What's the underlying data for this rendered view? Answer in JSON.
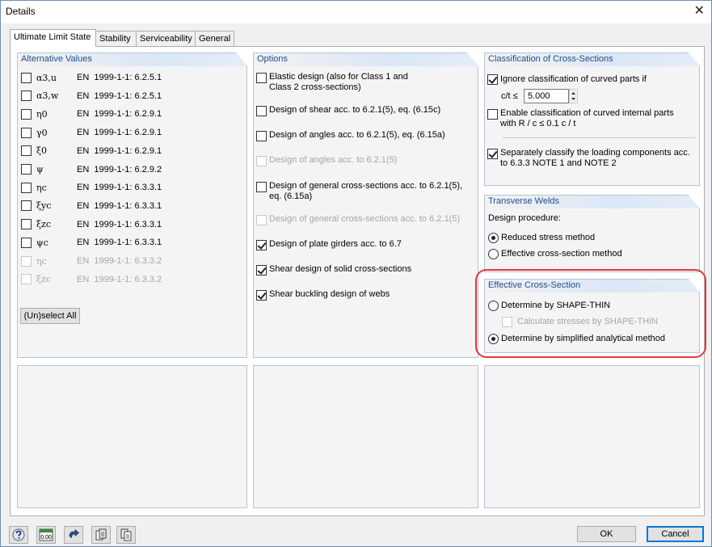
{
  "window": {
    "title": "Details",
    "close_symbol": "✕"
  },
  "tabs": [
    {
      "label": "Ultimate Limit State",
      "active": true
    },
    {
      "label": "Stability",
      "active": false
    },
    {
      "label": "Serviceability",
      "active": false
    },
    {
      "label": "General",
      "active": false
    }
  ],
  "alternative_values": {
    "title": "Alternative Values",
    "rows": [
      {
        "symbol": "α3,u",
        "ref": "EN  1999-1-1: 6.2.5.1",
        "checked": false,
        "enabled": true
      },
      {
        "symbol": "α3,w",
        "ref": "EN  1999-1-1: 6.2.5.1",
        "checked": false,
        "enabled": true
      },
      {
        "symbol": "η0",
        "ref": "EN  1999-1-1: 6.2.9.1",
        "checked": false,
        "enabled": true
      },
      {
        "symbol": "γ0",
        "ref": "EN  1999-1-1: 6.2.9.1",
        "checked": false,
        "enabled": true
      },
      {
        "symbol": "ξ0",
        "ref": "EN  1999-1-1: 6.2.9.1",
        "checked": false,
        "enabled": true
      },
      {
        "symbol": "ψ",
        "ref": "EN  1999-1-1: 6.2.9.2",
        "checked": false,
        "enabled": true
      },
      {
        "symbol": "ηc",
        "ref": "EN  1999-1-1: 6.3.3.1",
        "checked": false,
        "enabled": true
      },
      {
        "symbol": "ξyc",
        "ref": "EN  1999-1-1: 6.3.3.1",
        "checked": false,
        "enabled": true
      },
      {
        "symbol": "ξzc",
        "ref": "EN  1999-1-1: 6.3.3.1",
        "checked": false,
        "enabled": true
      },
      {
        "symbol": "ψc",
        "ref": "EN  1999-1-1: 6.3.3.1",
        "checked": false,
        "enabled": true
      },
      {
        "symbol": "ηc",
        "ref": "EN  1999-1-1: 6.3.3.2",
        "checked": false,
        "enabled": false
      },
      {
        "symbol": "ξzc",
        "ref": "EN  1999-1-1: 6.3.3.2",
        "checked": false,
        "enabled": false
      }
    ],
    "unselect_all_label": "(Un)select All"
  },
  "options": {
    "title": "Options",
    "items": [
      {
        "label": "Elastic design (also for Class 1 and\nClass 2 cross-sections)",
        "checked": false,
        "enabled": true
      },
      {
        "label": "Design of shear acc. to 6.2.1(5), eq. (6.15c)",
        "checked": false,
        "enabled": true
      },
      {
        "label": "Design of angles acc. to 6.2.1(5), eq. (6.15a)",
        "checked": false,
        "enabled": true
      },
      {
        "label": "Design of angles acc. to 6.2.1(5)",
        "checked": false,
        "enabled": false
      },
      {
        "label": "Design of general cross-sections acc. to 6.2.1(5),\neq. (6.15a)",
        "checked": false,
        "enabled": true
      },
      {
        "label": "Design of general cross-sections acc. to 6.2.1(5)",
        "checked": false,
        "enabled": false
      },
      {
        "label": "Design of plate girders acc. to 6.7",
        "checked": true,
        "enabled": true
      },
      {
        "label": "Shear design of solid cross-sections",
        "checked": true,
        "enabled": true
      },
      {
        "label": "Shear buckling design of webs",
        "checked": true,
        "enabled": true
      }
    ]
  },
  "classification": {
    "title": "Classification of Cross-Sections",
    "ignore_curved_label": "Ignore classification of curved parts if",
    "ignore_curved_checked": true,
    "ct_label": "c/t ≤",
    "ct_value": "5.000",
    "enable_curved_label": "Enable classification of curved internal parts\nwith R / c ≤ 0.1 c / t",
    "enable_curved_checked": false,
    "separately_label": "Separately classify the loading components acc.\nto 6.3.3 NOTE 1 and NOTE 2",
    "separately_checked": true
  },
  "transverse_welds": {
    "title": "Transverse Welds",
    "procedure_label": "Design procedure:",
    "options": [
      {
        "label": "Reduced stress method",
        "selected": true
      },
      {
        "label": "Effective cross-section method",
        "selected": false
      }
    ]
  },
  "effective_cross_section": {
    "title": "Effective Cross-Section",
    "shape_thin_label": "Determine by SHAPE-THIN",
    "shape_thin_selected": false,
    "calc_stresses_label": "Calculate stresses by SHAPE-THIN",
    "calc_stresses_checked": false,
    "simplified_label": "Determine by simplified analytical method",
    "simplified_selected": true
  },
  "footer": {
    "ok_label": "OK",
    "cancel_label": "Cancel",
    "icons": [
      "help-icon",
      "units-icon",
      "reset-icon",
      "export-icon",
      "import-icon"
    ],
    "units_text": "0.00"
  },
  "colors": {
    "highlight": "#e0383e",
    "box_header_text": "#1f4e8c"
  }
}
